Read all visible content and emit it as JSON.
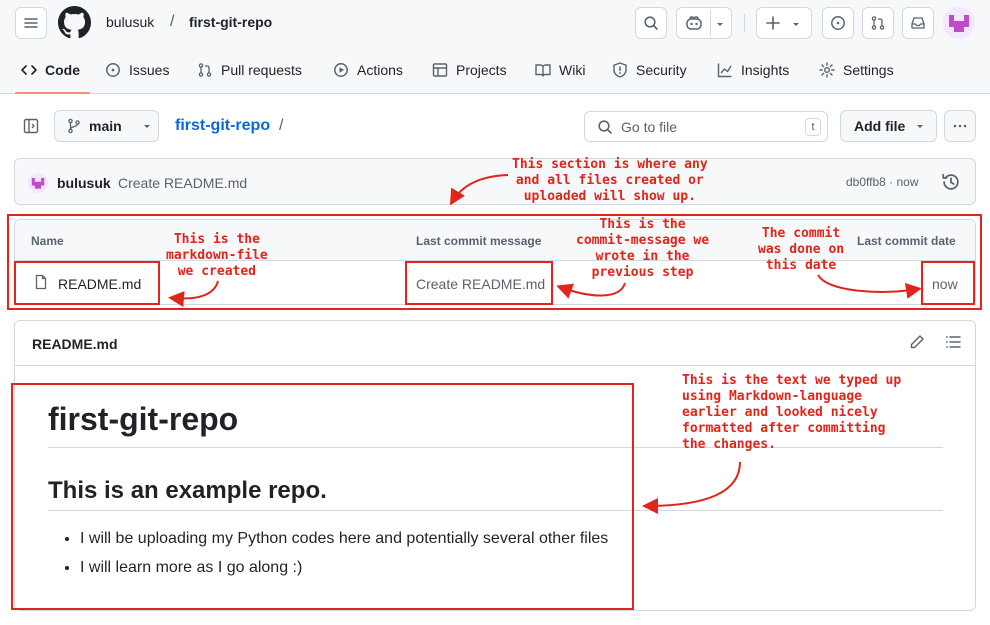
{
  "header": {
    "owner": "bulusuk",
    "separator": "/",
    "repo": "first-git-repo"
  },
  "tabs": [
    {
      "label": "Code",
      "icon": "code-icon",
      "active": true
    },
    {
      "label": "Issues",
      "icon": "issue-icon"
    },
    {
      "label": "Pull requests",
      "icon": "pull-request-icon"
    },
    {
      "label": "Actions",
      "icon": "play-icon"
    },
    {
      "label": "Projects",
      "icon": "table-icon"
    },
    {
      "label": "Wiki",
      "icon": "book-icon"
    },
    {
      "label": "Security",
      "icon": "shield-icon"
    },
    {
      "label": "Insights",
      "icon": "graph-icon"
    },
    {
      "label": "Settings",
      "icon": "gear-icon"
    }
  ],
  "toolbar": {
    "branch": "main",
    "path_repo": "first-git-repo",
    "path_slash": "/",
    "goto_placeholder": "Go to file",
    "goto_shortcut": "t",
    "add_file": "Add file"
  },
  "commit": {
    "author": "bulusuk",
    "message": "Create README.md",
    "sha_time": "db0ffb8 · now"
  },
  "file_table": {
    "columns": [
      "Name",
      "Last commit message",
      "Last commit date"
    ],
    "rows": [
      {
        "name": "README.md",
        "commit_message": "Create README.md",
        "date": "now"
      }
    ]
  },
  "readme": {
    "title": "README.md",
    "h1": "first-git-repo",
    "h2": "This is an example repo.",
    "items": [
      "I will be uploading my Python codes here and potentially several other files",
      "I will learn more as I go along :)"
    ]
  },
  "annotations": {
    "section": "This section is where any\nand all files created or\nuploaded will show up.",
    "markdown_file": "This is the\nmarkdown-file\nwe created",
    "commit_message": "This is the\ncommit-message we\nwrote in the\nprevious step",
    "commit_date": "The commit\nwas done on\nthis date",
    "text": "This is the text we typed up\nusing Markdown-language\nearlier and looked nicely\nformatted after committing\nthe changes."
  },
  "colors": {
    "annotation": "#e0251b",
    "link": "#0969da",
    "tab_underline": "#fd8c73"
  }
}
